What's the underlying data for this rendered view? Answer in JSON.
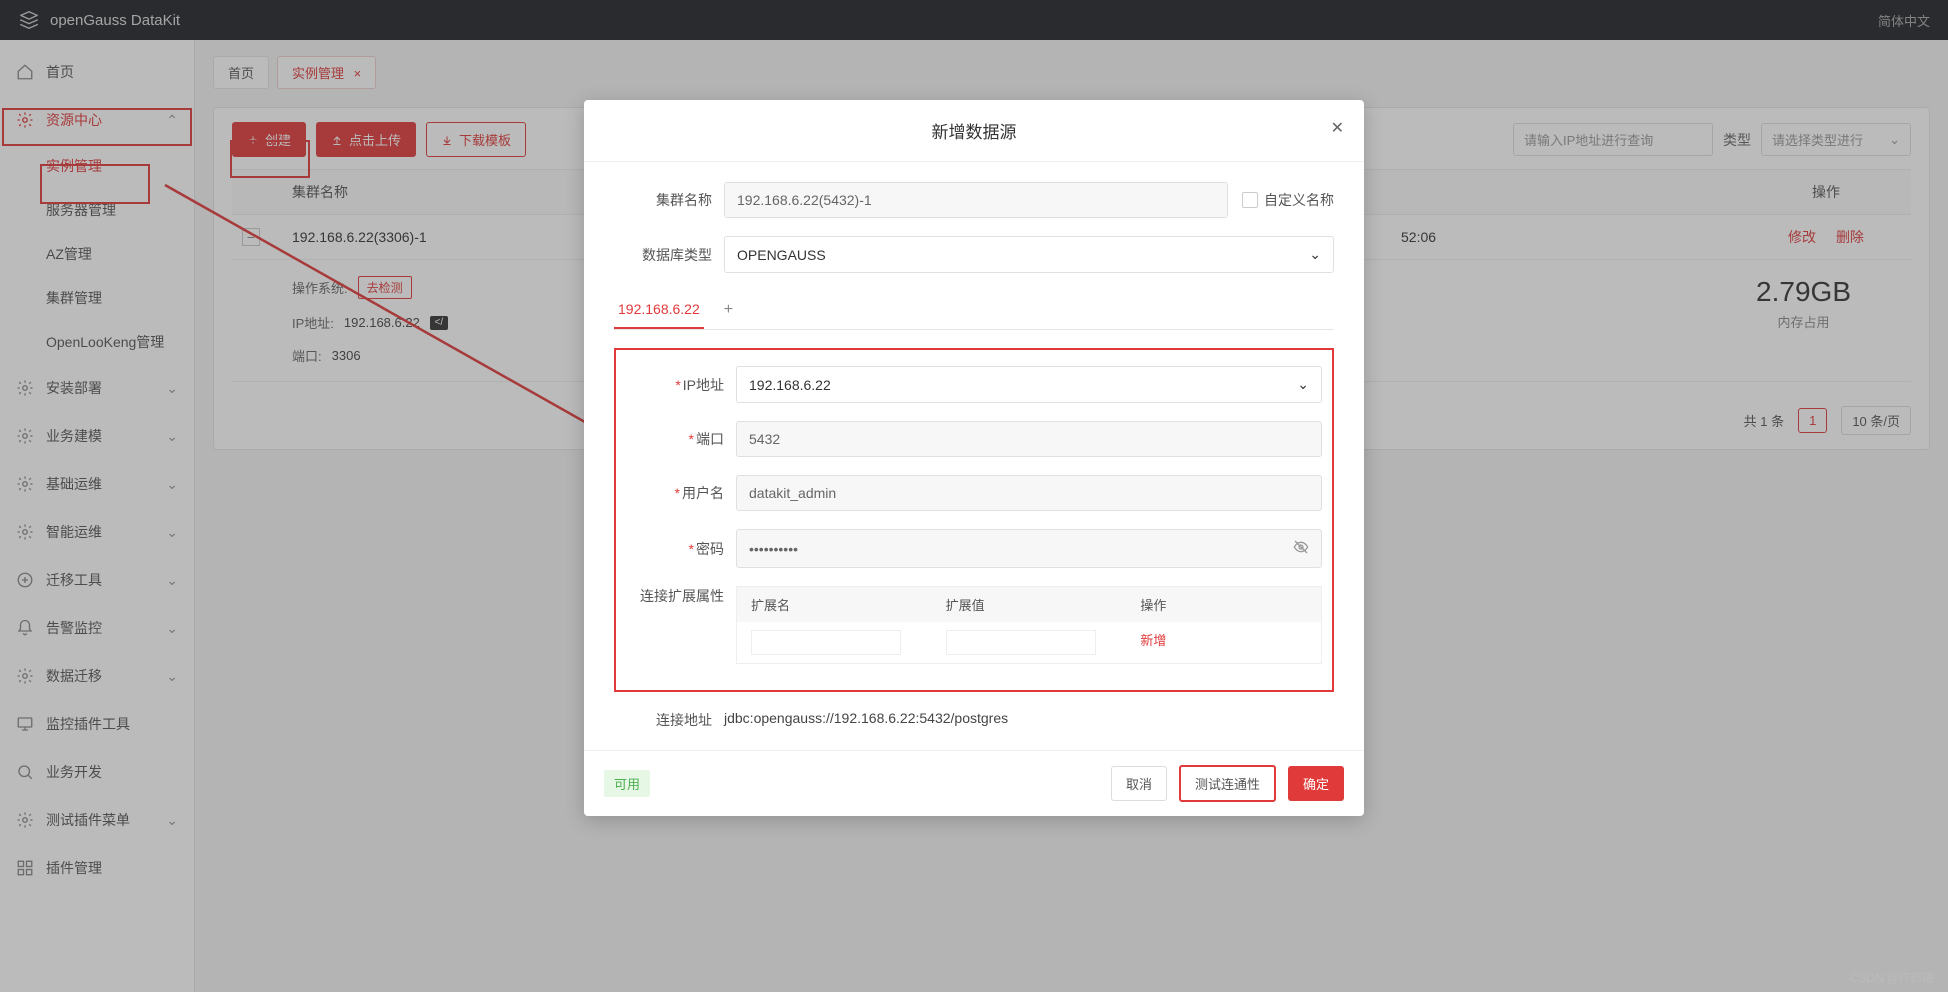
{
  "header": {
    "title": "openGauss DataKit",
    "lang": "简体中文"
  },
  "sidebar": {
    "home": "首页",
    "resource": "资源中心",
    "items": [
      "实例管理",
      "服务器管理",
      "AZ管理",
      "集群管理",
      "OpenLooKeng管理"
    ],
    "groups": [
      "安装部署",
      "业务建模",
      "基础运维",
      "智能运维",
      "迁移工具",
      "告警监控",
      "数据迁移"
    ],
    "others": [
      "监控插件工具",
      "业务开发",
      "测试插件菜单",
      "插件管理"
    ]
  },
  "breadcrumb": {
    "home": "首页",
    "active": "实例管理"
  },
  "toolbar": {
    "create": "创建",
    "upload": "点击上传",
    "download": "下载模板",
    "search_placeholder": "请输入IP地址进行查询",
    "type_label": "类型",
    "type_placeholder": "请选择类型进行"
  },
  "table": {
    "col_name": "集群名称",
    "col_time_end": "52:06",
    "col_actions": "操作",
    "row_name": "192.168.6.22(3306)-1",
    "action_edit": "修改",
    "action_delete": "删除"
  },
  "detail": {
    "os_label": "操作系统:",
    "os_btn": "去检测",
    "ip_label": "IP地址:",
    "ip_val": "192.168.6.22",
    "port_label": "端口:",
    "port_val": "3306",
    "mem_val": "2.79GB",
    "mem_label": "内存占用"
  },
  "pagination": {
    "total": "共 1 条",
    "page": "1",
    "size": "10 条/页"
  },
  "modal": {
    "title": "新增数据源",
    "cluster_label": "集群名称",
    "cluster_val": "192.168.6.22(5432)-1",
    "custom_name": "自定义名称",
    "dbtype_label": "数据库类型",
    "dbtype_val": "OPENGAUSS",
    "ip_tab": "192.168.6.22",
    "ip_label": "IP地址",
    "ip_val": "192.168.6.22",
    "port_label": "端口",
    "port_val": "5432",
    "user_label": "用户名",
    "user_val": "datakit_admin",
    "pw_label": "密码",
    "pw_val": "••••••••••",
    "ext_label": "连接扩展属性",
    "ext_col1": "扩展名",
    "ext_col2": "扩展值",
    "ext_col3": "操作",
    "ext_add": "新增",
    "url_label": "连接地址",
    "url_val": "jdbc:opengauss://192.168.6.22:5432/postgres",
    "status": "可用",
    "cancel": "取消",
    "test": "测试连通性",
    "ok": "确定"
  },
  "watermark": "CSDN @IT邦德"
}
